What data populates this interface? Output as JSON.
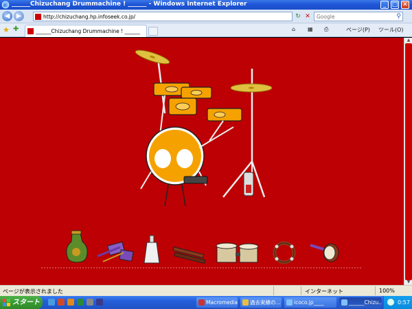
{
  "window": {
    "title": "______Chizuchang Drummachine ! ______ - Windows Internet Explorer",
    "buttons": {
      "minimize": "_",
      "maximize": "□",
      "close": "✕"
    }
  },
  "addressbar": {
    "url": "http://chizuchang.hp.infoseek.co.jp/",
    "search_placeholder": "Google",
    "back_glyph": "◀",
    "forward_glyph": "▶",
    "refresh_glyph": "↻",
    "stop_glyph": "✕",
    "search_glyph": "⚲"
  },
  "tabs": [
    {
      "label": "______Chizuchang Drummachine ! ______"
    }
  ],
  "commandbar": {
    "page": "ページ(P)",
    "tools": "ツール(O)"
  },
  "statusbar": {
    "text": "ページが表示されました",
    "zone": "インターネット",
    "zoom": "100%"
  },
  "taskbar": {
    "start": "スタート",
    "buttons": [
      {
        "label": "Macromedia ..."
      },
      {
        "label": "過去実績の..."
      },
      {
        "label": "icoco.jp____"
      },
      {
        "label": "______Chizu..."
      }
    ],
    "clock": "0:57"
  },
  "colors": {
    "stage_background": "#bd0004",
    "drum_orange": "#f5a200",
    "taskbar_blue": "#245edb",
    "start_green": "#3a9a33"
  },
  "instruments": [
    {
      "name": "shaker-vase"
    },
    {
      "name": "block-mallets"
    },
    {
      "name": "cowbell"
    },
    {
      "name": "claves"
    },
    {
      "name": "bongos"
    },
    {
      "name": "tambourine"
    },
    {
      "name": "hand-drum"
    }
  ]
}
